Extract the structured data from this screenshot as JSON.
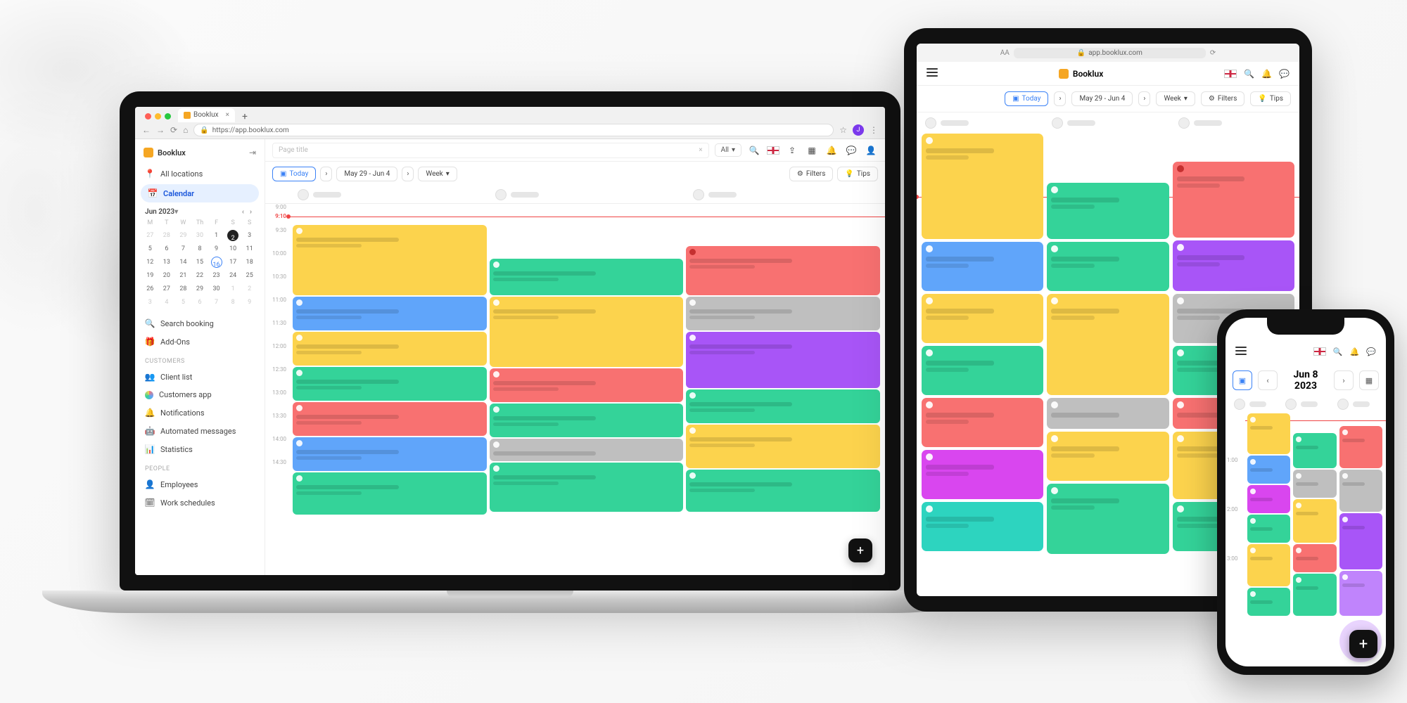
{
  "browser": {
    "tab_title": "Booklux",
    "url": "https://app.booklux.com"
  },
  "app": {
    "brand": "Booklux",
    "page_title_placeholder": "Page title",
    "filter_all": "All"
  },
  "sidebar": {
    "all_locations": "All locations",
    "calendar": "Calendar",
    "search_booking": "Search booking",
    "addons": "Add-Ons",
    "section_customers": "CUSTOMERS",
    "client_list": "Client list",
    "customers_app": "Customers app",
    "notifications": "Notifications",
    "automated_messages": "Automated messages",
    "statistics": "Statistics",
    "section_people": "PEOPLE",
    "employees": "Employees",
    "work_schedules": "Work schedules"
  },
  "minical": {
    "month_label": "Jun 2023",
    "dow": [
      "M",
      "T",
      "W",
      "Th",
      "F",
      "S",
      "S"
    ],
    "weeks": [
      [
        {
          "n": "27",
          "o": true
        },
        {
          "n": "28",
          "o": true
        },
        {
          "n": "29",
          "o": true
        },
        {
          "n": "30",
          "o": true
        },
        {
          "n": "1"
        },
        {
          "n": "2",
          "tod": true
        },
        {
          "n": "3"
        }
      ],
      [
        {
          "n": "5"
        },
        {
          "n": "6"
        },
        {
          "n": "7"
        },
        {
          "n": "8"
        },
        {
          "n": "9"
        },
        {
          "n": "10"
        },
        {
          "n": "11"
        }
      ],
      [
        {
          "n": "12"
        },
        {
          "n": "13"
        },
        {
          "n": "14"
        },
        {
          "n": "15"
        },
        {
          "n": "16",
          "sel": true
        },
        {
          "n": "17"
        },
        {
          "n": "18"
        }
      ],
      [
        {
          "n": "19"
        },
        {
          "n": "20"
        },
        {
          "n": "21"
        },
        {
          "n": "22"
        },
        {
          "n": "23"
        },
        {
          "n": "24"
        },
        {
          "n": "25"
        }
      ],
      [
        {
          "n": "26"
        },
        {
          "n": "27"
        },
        {
          "n": "28"
        },
        {
          "n": "29"
        },
        {
          "n": "30"
        },
        {
          "n": "1",
          "o": true
        },
        {
          "n": "2",
          "o": true
        }
      ],
      [
        {
          "n": "3",
          "o": true
        },
        {
          "n": "4",
          "o": true
        },
        {
          "n": "5",
          "o": true
        },
        {
          "n": "6",
          "o": true
        },
        {
          "n": "7",
          "o": true
        },
        {
          "n": "8",
          "o": true
        },
        {
          "n": "9",
          "o": true
        }
      ]
    ]
  },
  "toolbar": {
    "today": "Today",
    "date_range": "May 29 - Jun 4",
    "view": "Week",
    "filters": "Filters",
    "tips": "Tips"
  },
  "timeline": {
    "now_label": "9:10",
    "hours": [
      "9:00",
      "9:30",
      "10:00",
      "10:30",
      "11:00",
      "11:30",
      "12:00",
      "12:30",
      "13:00",
      "13:30",
      "14:00",
      "14:30"
    ]
  },
  "tablet": {
    "url": "app.booklux.com",
    "brand": "Booklux",
    "today": "Today",
    "date_range": "May 29 - Jun 4",
    "view": "Week",
    "filters": "Filters",
    "tips": "Tips"
  },
  "phone": {
    "date": "Jun 8 2023",
    "hours": [
      "1:00",
      "2:00",
      "3:00"
    ]
  }
}
